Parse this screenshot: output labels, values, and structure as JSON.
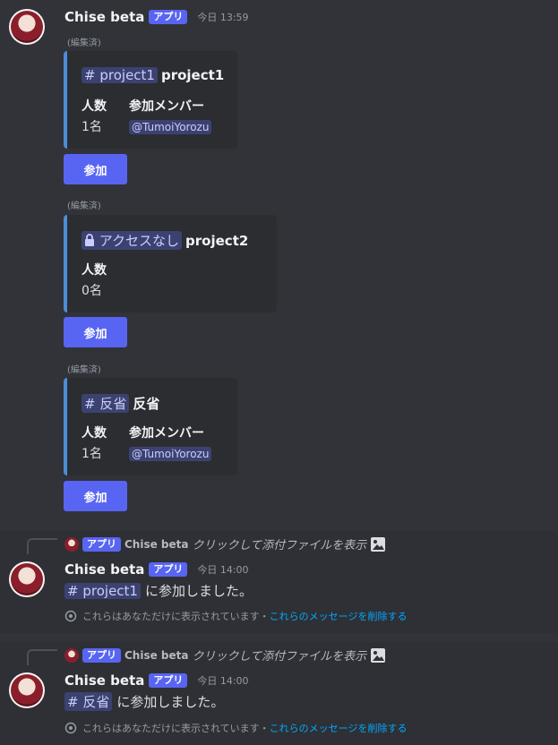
{
  "message1": {
    "author": "Chise beta",
    "badge": "アプリ",
    "time": "今日 13:59",
    "edited": "(編集済)"
  },
  "embeds": [
    {
      "channel_icon": "#",
      "channel": "project1",
      "title": "project1",
      "field1_name": "人数",
      "field1_value": "1名",
      "field2_name": "参加メンバー",
      "field2_value": "@TumoiYorozu",
      "button": "参加",
      "edited": "(編集済)"
    },
    {
      "channel": "アクセスなし",
      "title": "project2",
      "field1_name": "人数",
      "field1_value": "0名",
      "button": "参加",
      "edited": "(編集済)"
    },
    {
      "channel_icon": "#",
      "channel": "反省",
      "title": "反省",
      "field1_name": "人数",
      "field1_value": "1名",
      "field2_name": "参加メンバー",
      "field2_value": "@TumoiYorozu",
      "button": "参加"
    }
  ],
  "reply1": {
    "ref_badge": "アプリ",
    "ref_author": "Chise beta",
    "ref_text": "クリックして添付ファイルを表示",
    "author": "Chise beta",
    "badge": "アプリ",
    "time": "今日 14:00",
    "channel_icon": "#",
    "channel": "project1",
    "text": "に参加しました。",
    "eph_text": "これらはあなただけに表示されています・",
    "eph_link": "これらのメッセージを削除する"
  },
  "reply2": {
    "ref_badge": "アプリ",
    "ref_author": "Chise beta",
    "ref_text": "クリックして添付ファイルを表示",
    "author": "Chise beta",
    "badge": "アプリ",
    "time": "今日 14:00",
    "channel_icon": "#",
    "channel": "反省",
    "text": "に参加しました。",
    "eph_text": "これらはあなただけに表示されています・",
    "eph_link": "これらのメッセージを削除する"
  },
  "colors": {
    "background": "#313338",
    "accent": "#5865f2",
    "embed_border": "#4a8ed8",
    "link": "#00a8fc"
  }
}
